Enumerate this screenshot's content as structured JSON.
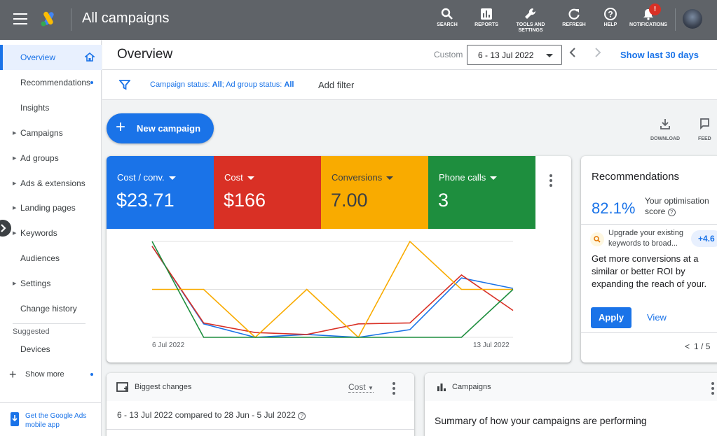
{
  "app": {
    "title": "All campaigns",
    "nav": [
      {
        "label": "SEARCH",
        "icon": "search-icon"
      },
      {
        "label": "REPORTS",
        "icon": "reports-icon"
      },
      {
        "label": "TOOLS AND SETTINGS",
        "icon": "wrench-icon"
      },
      {
        "label": "REFRESH",
        "icon": "refresh-icon"
      },
      {
        "label": "HELP",
        "icon": "help-icon"
      },
      {
        "label": "NOTIFICATIONS",
        "icon": "bell-icon"
      }
    ],
    "notification_badge": "!"
  },
  "sidebar": {
    "items": [
      {
        "label": "Overview",
        "active": true
      },
      {
        "label": "Recommendations",
        "dot": true
      },
      {
        "label": "Insights"
      },
      {
        "label": "Campaigns",
        "caret": true
      },
      {
        "label": "Ad groups",
        "caret": true
      },
      {
        "label": "Ads & extensions",
        "caret": true
      },
      {
        "label": "Landing pages",
        "caret": true
      },
      {
        "label": "Keywords",
        "caret": true
      },
      {
        "label": "Audiences"
      },
      {
        "label": "Settings",
        "caret": true
      },
      {
        "label": "Change history"
      }
    ],
    "suggested_heading": "Suggested",
    "devices": "Devices",
    "show_more": "Show more",
    "mobile_app": "Get the Google Ads mobile app"
  },
  "header": {
    "title": "Overview",
    "custom": "Custom",
    "date_range": "6 - 13 Jul 2022",
    "show_last": "Show last 30 days"
  },
  "filter": {
    "status_prefix1": "Campaign status: ",
    "status_value1": "All",
    "status_prefix2": "; Ad group status: ",
    "status_value2": "All",
    "add_filter": "Add filter"
  },
  "actions": {
    "new_campaign": "New campaign",
    "download": "DOWNLOAD",
    "feedback": "FEED"
  },
  "metrics": [
    {
      "label": "Cost / conv.",
      "value": "$23.71",
      "color": "#1a73e8"
    },
    {
      "label": "Cost",
      "value": "$166",
      "color": "#d93025"
    },
    {
      "label": "Conversions",
      "value": "7.00",
      "color": "#f9ab00"
    },
    {
      "label": "Phone calls",
      "value": "3",
      "color": "#1e8e3e"
    }
  ],
  "chart_data": {
    "type": "line",
    "x": [
      "6 Jul 2022",
      "7 Jul 2022",
      "8 Jul 2022",
      "9 Jul 2022",
      "10 Jul 2022",
      "11 Jul 2022",
      "12 Jul 2022",
      "13 Jul 2022"
    ],
    "x_tick_labels": [
      "6 Jul 2022",
      "13 Jul 2022"
    ],
    "series": [
      {
        "color": "#1a73e8",
        "values": [
          0.95,
          0.14,
          0.0,
          0.03,
          0.0,
          0.08,
          0.62,
          0.51
        ]
      },
      {
        "color": "#d93025",
        "values": [
          0.95,
          0.15,
          0.05,
          0.03,
          0.14,
          0.15,
          0.65,
          0.28
        ]
      },
      {
        "color": "#f9ab00",
        "values": [
          0.5,
          0.5,
          0.0,
          0.5,
          0.0,
          1.0,
          0.5,
          0.5
        ]
      },
      {
        "color": "#1e8e3e",
        "values": [
          1.0,
          0.0,
          0.0,
          0.0,
          0.0,
          0.0,
          0.0,
          0.5
        ]
      }
    ],
    "ylim": [
      0,
      1
    ],
    "grid": true
  },
  "recommendations": {
    "title": "Recommendations",
    "score": "82.1%",
    "score_label": "Your optimisation score",
    "item": "Upgrade your existing keywords to broad...",
    "chip": "+4.6",
    "body": "Get more conversions at a similar or better ROI by expanding the reach of your.",
    "apply": "Apply",
    "view": "View",
    "pager": "1 / 5"
  },
  "biggest_changes": {
    "title": "Biggest changes",
    "metric": "Cost",
    "compare": "6 - 13 Jul 2022 compared to 28 Jun - 5 Jul 2022"
  },
  "campaigns_card": {
    "title": "Campaigns",
    "summary": "Summary of how your campaigns are performing"
  }
}
